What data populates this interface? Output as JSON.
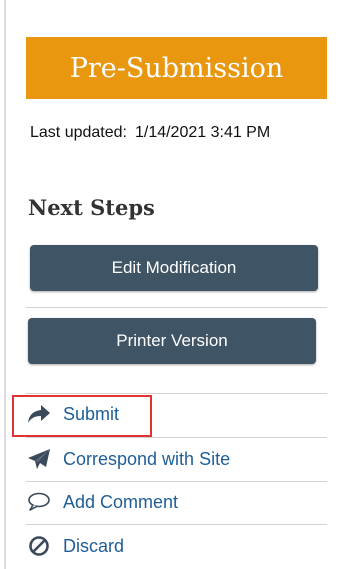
{
  "status": {
    "label": "Pre-Submission",
    "color": "#e8970f"
  },
  "last_updated": {
    "label": "Last updated:",
    "value": "1/14/2021 3:41 PM"
  },
  "next_steps": {
    "heading": "Next Steps",
    "buttons": [
      {
        "label": "Edit Modification"
      },
      {
        "label": "Printer Version"
      }
    ],
    "links": [
      {
        "label": "Submit",
        "icon": "share-arrow-icon",
        "highlighted": true
      },
      {
        "label": "Correspond with Site",
        "icon": "paper-plane-icon"
      },
      {
        "label": "Add Comment",
        "icon": "comment-bubble-icon"
      },
      {
        "label": "Discard",
        "icon": "discard-icon"
      }
    ]
  },
  "colors": {
    "button_bg": "#3f5465",
    "link": "#1f5e96",
    "highlight": "#e03434"
  }
}
